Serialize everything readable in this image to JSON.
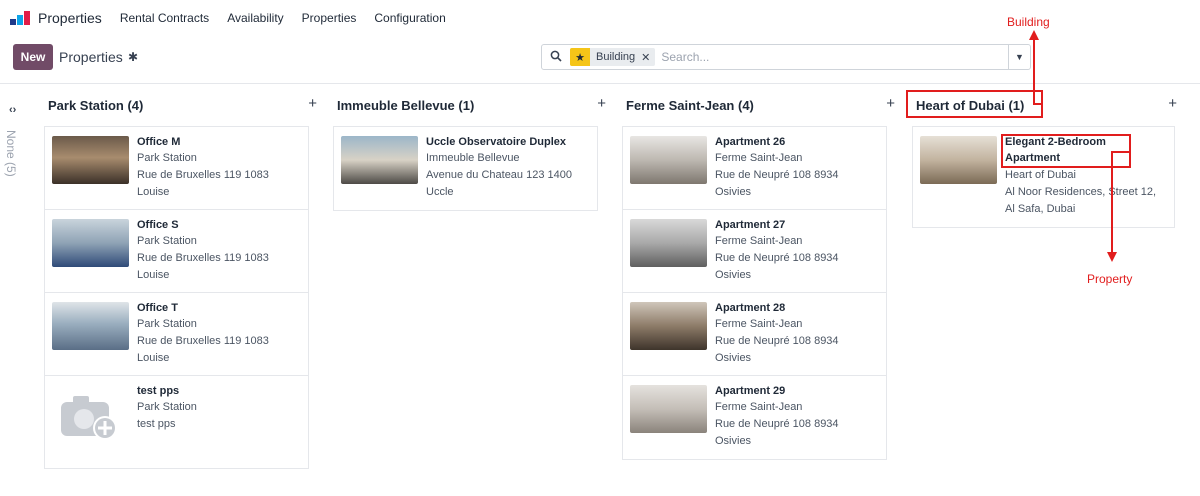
{
  "navbar": {
    "app_name": "Properties",
    "menu": [
      "Rental Contracts",
      "Availability",
      "Properties",
      "Configuration"
    ]
  },
  "control": {
    "new_label": "New",
    "title": "Properties",
    "search": {
      "facet_label": "Building",
      "placeholder": "Search..."
    }
  },
  "folded_column": {
    "label": "None (5)"
  },
  "columns": [
    {
      "title": "Park Station (4)",
      "cards": [
        {
          "title": "Office M",
          "building": "Park Station",
          "address_1": "Rue de Bruxelles 119 1083",
          "address_2": "Louise"
        },
        {
          "title": "Office S",
          "building": "Park Station",
          "address_1": "Rue de Bruxelles 119 1083",
          "address_2": "Louise"
        },
        {
          "title": "Office T",
          "building": "Park Station",
          "address_1": "Rue de Bruxelles 119 1083",
          "address_2": "Louise"
        },
        {
          "title": "test pps",
          "building": "Park Station",
          "address_1": "test pps",
          "address_2": ""
        }
      ]
    },
    {
      "title": "Immeuble Bellevue (1)",
      "cards": [
        {
          "title": "Uccle Observatoire Duplex",
          "building": "Immeuble Bellevue",
          "address_1": "Avenue du Chateau 123 1400",
          "address_2": "Uccle"
        }
      ]
    },
    {
      "title": "Ferme Saint-Jean (4)",
      "cards": [
        {
          "title": "Apartment 26",
          "building": "Ferme Saint-Jean",
          "address_1": "Rue de Neupré 108 8934",
          "address_2": "Osivies"
        },
        {
          "title": "Apartment 27",
          "building": "Ferme Saint-Jean",
          "address_1": "Rue de Neupré 108 8934",
          "address_2": "Osivies"
        },
        {
          "title": "Apartment 28",
          "building": "Ferme Saint-Jean",
          "address_1": "Rue de Neupré 108 8934",
          "address_2": "Osivies"
        },
        {
          "title": "Apartment 29",
          "building": "Ferme Saint-Jean",
          "address_1": "Rue de Neupré 108 8934",
          "address_2": "Osivies"
        }
      ]
    },
    {
      "title": "Heart of Dubai (1)",
      "cards": [
        {
          "title_1": "Elegant 2-Bedroom",
          "title_2": "Apartment",
          "building": "Heart of Dubai",
          "address_1": "Al Noor Residences, Street 12,",
          "address_2": "Al Safa, Dubai"
        }
      ]
    }
  ],
  "annotations": {
    "building": "Building",
    "property": "Property"
  },
  "colors": {
    "brand": "#714b67",
    "annotation": "#e11d1d",
    "facet_icon": "#f5c518"
  },
  "icons": [
    "app-logo-icon",
    "gear-icon",
    "search-icon",
    "star-icon",
    "close-icon",
    "chevron-down-icon",
    "fold-arrows-icon",
    "plus-icon",
    "camera-plus-icon"
  ]
}
